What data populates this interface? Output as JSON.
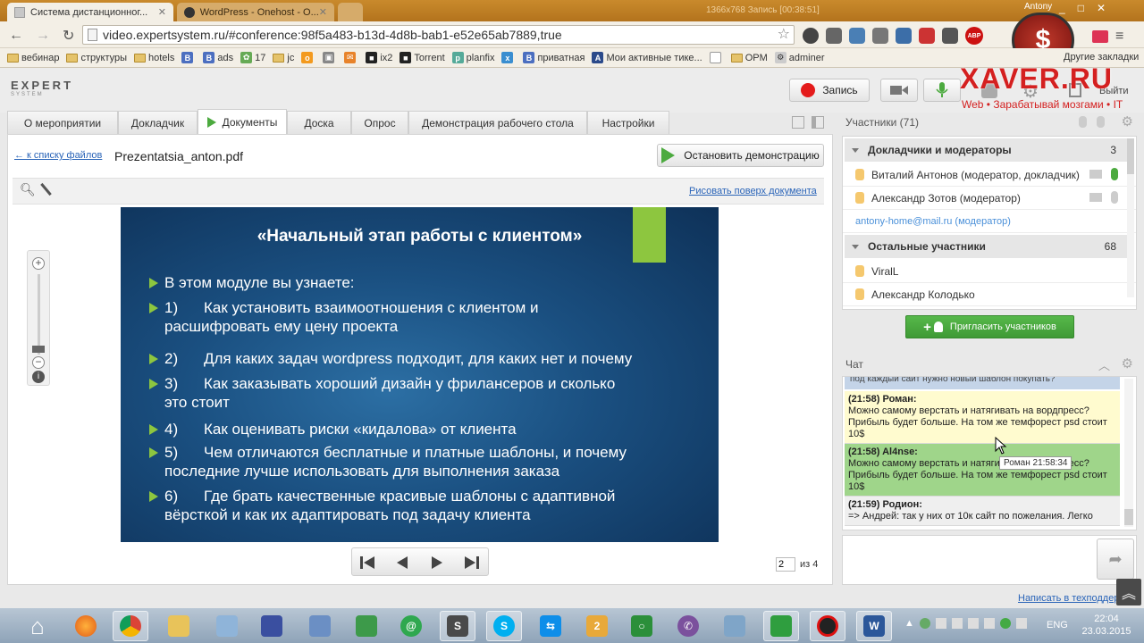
{
  "browser": {
    "tabs": [
      "Система дистанционног...",
      "WordPress - Onehost - O...",
      ""
    ],
    "window_controls": [
      "_",
      "□",
      "✕"
    ],
    "overlay_text": "1366x768   Запись [00:38:51]",
    "user": "Antony",
    "url": "video.expertsystem.ru/#conference:98f5a483-b13d-4d8b-bab1-e52e65ab7889,true",
    "bookmarks": [
      "вебинар",
      "структуры",
      "hotels",
      "",
      "ads",
      "17",
      "jc",
      "",
      "",
      "",
      "ix2",
      "Torrent",
      "planfix",
      "",
      "приватная",
      "Мои активные тике...",
      "",
      "OPM",
      "adminer"
    ],
    "other_bookmarks": "Другие закладки"
  },
  "app": {
    "logo_main": "EXPERT",
    "logo_sub": "SYSTEM",
    "record_label": "Запись",
    "exit_label": "Выйти",
    "watermark_title": "XAVER.RU",
    "watermark_sub": "Web • Зарабатывай мозгами • IT",
    "tabs": [
      "О мероприятии",
      "Докладчик",
      "Документы",
      "Доска",
      "Опрос",
      "Демонстрация рабочего стола",
      "Настройки"
    ]
  },
  "doc": {
    "back_link": "← к списку файлов",
    "filename": "Prezentatsia_anton.pdf",
    "stop_demo": "Остановить демонстрацию",
    "draw_link": "Рисовать поверх документа",
    "page_current": "2",
    "page_total": "из 4"
  },
  "slide": {
    "title": "«Начальный этап работы с клиентом»",
    "items": [
      {
        "n": "",
        "lines": [
          "В этом модуле вы узнаете:"
        ]
      },
      {
        "n": "1)",
        "lines": [
          "Как установить взаимоотношения с клиентом и",
          "расшифровать ему цену проекта"
        ]
      },
      {
        "n": "2)",
        "lines": [
          "Для каких задач wordpress подходит, для каких нет и почему"
        ]
      },
      {
        "n": "3)",
        "lines": [
          "Как заказывать хороший дизайн у фрилансеров и сколько",
          "это стоит"
        ]
      },
      {
        "n": "4)",
        "lines": [
          "Как оценивать риски «кидалова» от клиента"
        ]
      },
      {
        "n": "5)",
        "lines": [
          "Чем отличаются бесплатные и платные шаблоны, и почему",
          "последние лучше использовать для выполнения заказа"
        ]
      },
      {
        "n": "6)",
        "lines": [
          "Где брать качественные красивые шаблоны с адаптивной",
          "вёрсткой и как их адаптировать под задачу клиента"
        ]
      }
    ]
  },
  "participants": {
    "header": "Участники (71)",
    "speakers_group": "Докладчики и модераторы",
    "speakers_count": "3",
    "speakers": [
      "Виталий Антонов (модератор, докладчик)",
      "Александр Зотов (модератор)"
    ],
    "moderator_email": "antony-home@mail.ru (модератор)",
    "others_group": "Остальные участники",
    "others_count": "68",
    "others": [
      "ViralL",
      "Александр Колодько"
    ],
    "invite_button": "Пригласить участников"
  },
  "chat": {
    "header": "Чат",
    "cut_text": "под каждый сайт нужно новый шаблон покупать?",
    "messages": [
      {
        "head": "(21:58) Роман:",
        "lines": [
          "Можно самому верстать и натягивать на вордпресс?",
          "Прибыль будет больше. На том же темфорест psd стоит",
          "10$"
        ]
      },
      {
        "head": "(21:58) Al4nse:",
        "lines": [
          "Можно самому верстать и натягивать на вордпресс?",
          "Прибыль будет больше. На том же темфорест psd стоит",
          "10$"
        ]
      },
      {
        "head": "(21:59) Родион:",
        "lines": [
          "=> Андрей: так у них от 10к сайт по пожелания. Легко"
        ]
      }
    ],
    "tooltip": "Роман 21:58:34",
    "support_link": "Написать в техподдержку"
  },
  "taskbar": {
    "lang": "ENG",
    "time": "22:04",
    "date": "23.03.2015"
  },
  "colors": {
    "accent_green": "#4caa3f",
    "slide_bg": "#1a4f80",
    "bullet_green": "#8dc63f",
    "link_blue": "#2a64b8",
    "record_red": "#e41b1b"
  }
}
